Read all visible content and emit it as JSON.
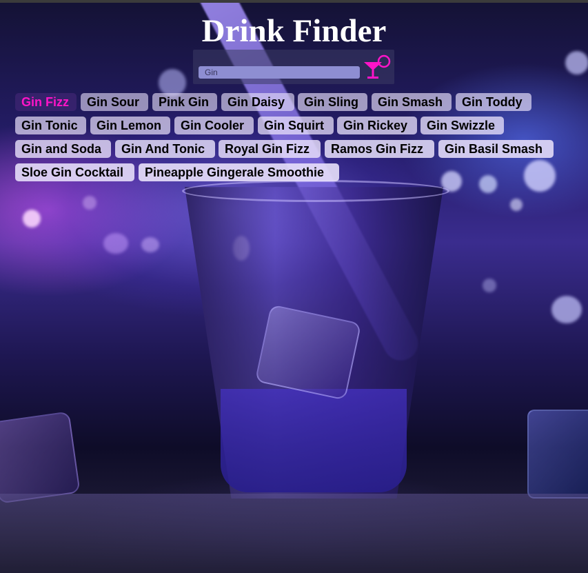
{
  "app": {
    "title": "Drink Finder"
  },
  "search": {
    "value": "Gin",
    "placeholder": ""
  },
  "colors": {
    "accent": "#ff14c8",
    "title": "#ffffff",
    "chip_text": "#000000"
  },
  "results": [
    {
      "label": "Gin Fizz",
      "active": true
    },
    {
      "label": "Gin Sour",
      "active": false
    },
    {
      "label": "Pink Gin",
      "active": false
    },
    {
      "label": "Gin Daisy",
      "active": false
    },
    {
      "label": "Gin Sling",
      "active": false
    },
    {
      "label": "Gin Smash",
      "active": false
    },
    {
      "label": "Gin Toddy",
      "active": false
    },
    {
      "label": "Gin Tonic",
      "active": false
    },
    {
      "label": "Gin Lemon",
      "active": false
    },
    {
      "label": "Gin Cooler",
      "active": false
    },
    {
      "label": "Gin Squirt",
      "active": false
    },
    {
      "label": "Gin Rickey",
      "active": false
    },
    {
      "label": "Gin Swizzle",
      "active": false
    },
    {
      "label": "Gin and Soda",
      "active": false
    },
    {
      "label": "Gin And Tonic",
      "active": false
    },
    {
      "label": "Royal Gin Fizz",
      "active": false
    },
    {
      "label": "Ramos Gin Fizz",
      "active": false
    },
    {
      "label": "Gin Basil Smash",
      "active": false
    },
    {
      "label": "Sloe Gin Cocktail",
      "active": false
    },
    {
      "label": "Pineapple Gingerale Smoothie",
      "active": false
    }
  ],
  "icons": {
    "search_button": "cocktail-glass-icon"
  }
}
